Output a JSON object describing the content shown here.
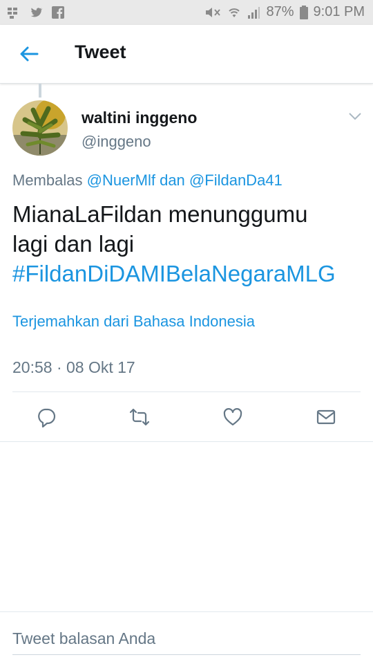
{
  "status_bar": {
    "battery": "87%",
    "time": "9:01 PM",
    "left_icons": [
      "bbm-icon",
      "twitter-icon",
      "facebook-icon"
    ],
    "right_icons": [
      "mute-icon",
      "wifi-icon",
      "signal-icon",
      "battery-icon"
    ]
  },
  "header": {
    "title": "Tweet",
    "back_icon": "back-arrow-icon"
  },
  "tweet": {
    "name": "waltini inggeno",
    "handle": "@inggeno",
    "reply_prefix": "Membalas",
    "reply_user1": "@NuerMlf",
    "reply_conj": "dan",
    "reply_user2": "@FildanDa41",
    "text_line1": "MianaLaFildan menunggumu",
    "text_line2": "lagi dan lagi",
    "hashtag": "#FildanDiDAMIBelaNegaraMLG",
    "translate": "Terjemahkan dari Bahasa Indonesia",
    "timestamp": "20:58 · 08 Okt 17"
  },
  "actions": [
    "reply-icon",
    "retweet-icon",
    "like-icon",
    "direct-message-icon"
  ],
  "reply_box": {
    "placeholder": "Tweet balasan Anda"
  },
  "colors": {
    "accent": "#1b95e0",
    "secondary_text": "#657786",
    "status_bar_bg": "#e9e9e9"
  }
}
